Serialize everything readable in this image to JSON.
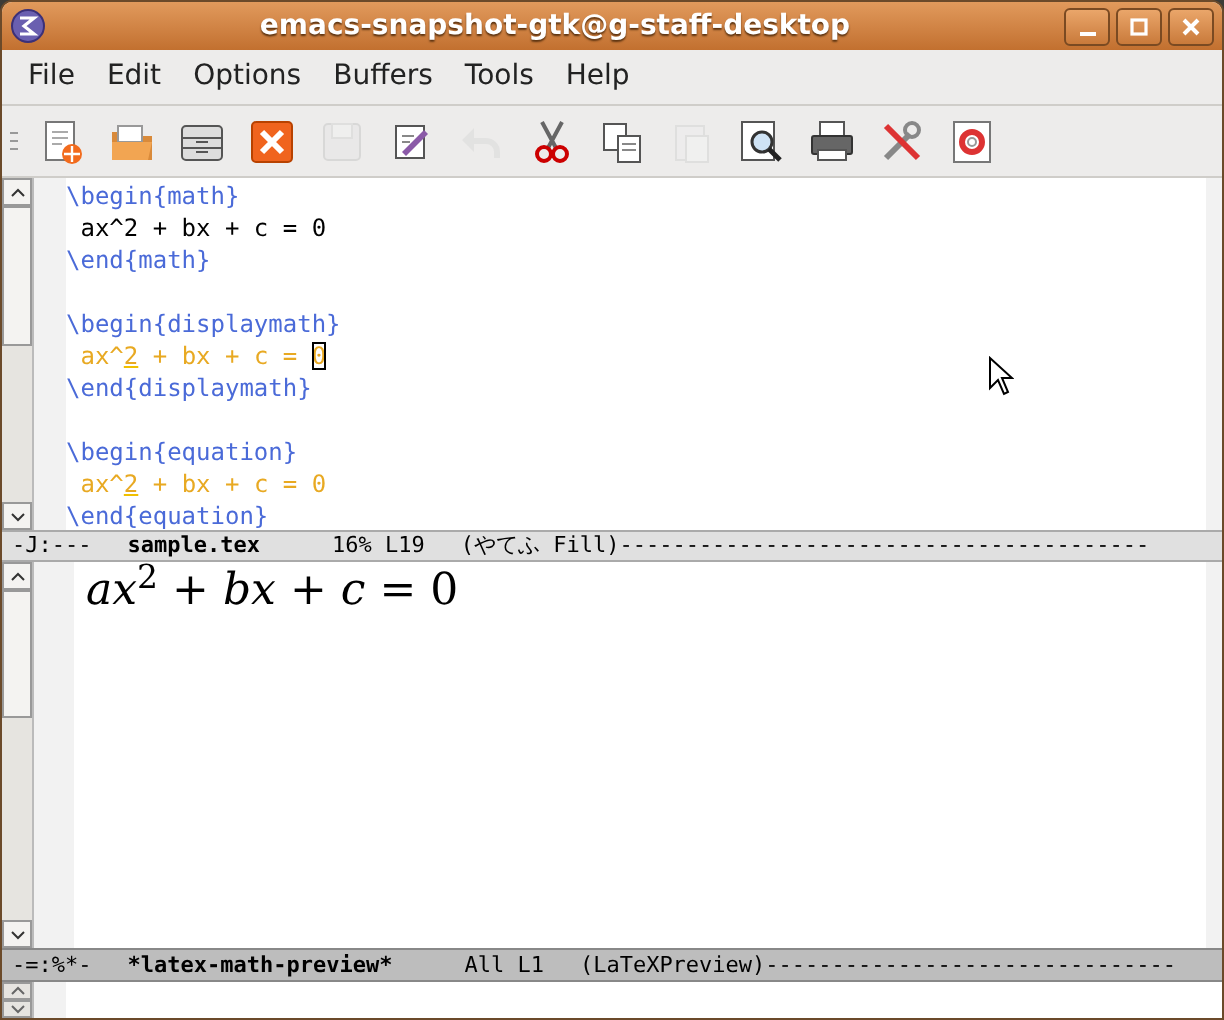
{
  "window": {
    "title": "emacs-snapshot-gtk@g-staff-desktop"
  },
  "menu": [
    "File",
    "Edit",
    "Options",
    "Buffers",
    "Tools",
    "Help"
  ],
  "toolbar": [
    {
      "kind": "new",
      "disabled": false
    },
    {
      "kind": "open",
      "disabled": false
    },
    {
      "kind": "dired",
      "disabled": false
    },
    {
      "kind": "close",
      "disabled": false
    },
    {
      "kind": "save",
      "disabled": true
    },
    {
      "kind": "edit",
      "disabled": false
    },
    {
      "kind": "undo",
      "disabled": true
    },
    {
      "kind": "cut",
      "disabled": false
    },
    {
      "kind": "copy",
      "disabled": false
    },
    {
      "kind": "paste",
      "disabled": true
    },
    {
      "kind": "search",
      "disabled": false
    },
    {
      "kind": "print",
      "disabled": false
    },
    {
      "kind": "customize",
      "disabled": false
    },
    {
      "kind": "help",
      "disabled": false
    }
  ],
  "editor": {
    "lines": [
      {
        "kind": "code",
        "segments": [
          {
            "text": "\\begin{math}",
            "kind": "command"
          }
        ]
      },
      {
        "kind": "code",
        "segments": [
          {
            "text": " ax^2 + bx + c = 0",
            "kind": "plain"
          }
        ]
      },
      {
        "kind": "code",
        "segments": [
          {
            "text": "\\end{math}",
            "kind": "command"
          }
        ]
      },
      {
        "kind": "blank"
      },
      {
        "kind": "code",
        "segments": [
          {
            "text": "\\begin{displaymath}",
            "kind": "command"
          }
        ]
      },
      {
        "kind": "code",
        "segments": [
          {
            "text": " ax^",
            "kind": "math"
          },
          {
            "text": "2",
            "kind": "script"
          },
          {
            "text": " + bx + c = ",
            "kind": "math"
          },
          {
            "text": "0",
            "kind": "cursor"
          }
        ]
      },
      {
        "kind": "code",
        "segments": [
          {
            "text": "\\end{displaymath}",
            "kind": "command"
          }
        ]
      },
      {
        "kind": "blank"
      },
      {
        "kind": "code",
        "segments": [
          {
            "text": "\\begin{equation}",
            "kind": "command"
          }
        ]
      },
      {
        "kind": "code",
        "segments": [
          {
            "text": " ax^",
            "kind": "math"
          },
          {
            "text": "2",
            "kind": "script"
          },
          {
            "text": " + bx + c = 0",
            "kind": "math"
          }
        ]
      },
      {
        "kind": "code",
        "segments": [
          {
            "text": "\\end{equation}",
            "kind": "command"
          }
        ]
      }
    ],
    "mode_line": {
      "status": "-J:---",
      "buffer": "sample.tex",
      "position": "16% L19",
      "mode": "(やてふ Fill)",
      "fill": "----------------------------------------"
    }
  },
  "preview": {
    "formula": "*ax*$^{2}$ + *bx* + *c* = 0",
    "mode_line": {
      "status": "-=:%*-",
      "buffer": "*latex-math-preview*",
      "position": "All L1",
      "mode": "(LaTeXPreview)",
      "fill": "-------------------------------"
    }
  }
}
